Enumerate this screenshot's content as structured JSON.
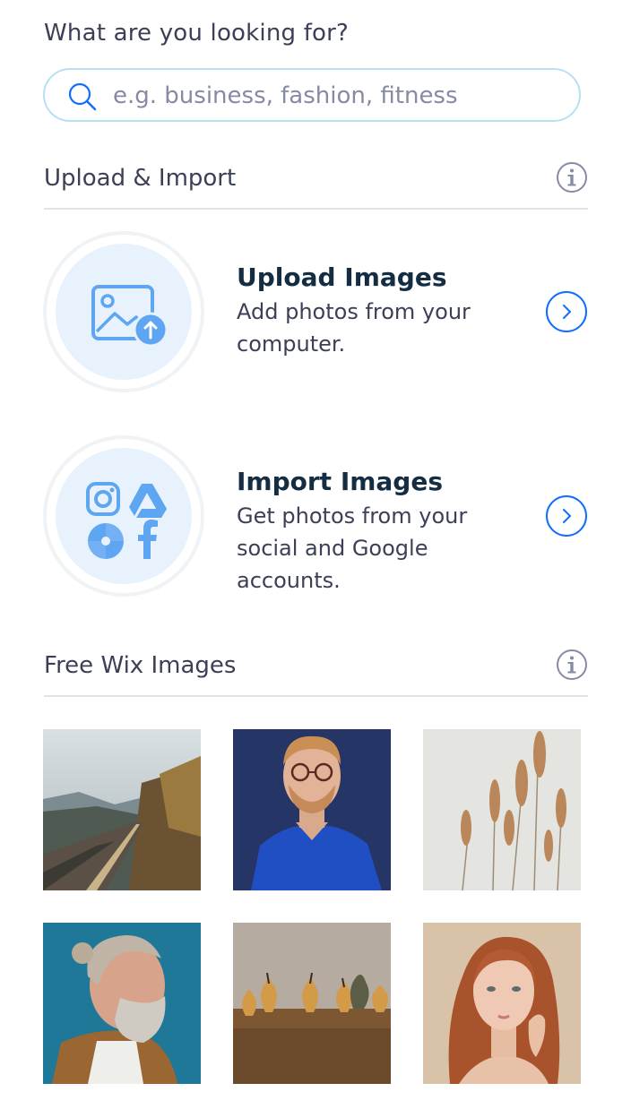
{
  "search": {
    "label": "What are you looking for?",
    "placeholder": "e.g. business, fashion, fitness"
  },
  "upload_section": {
    "title": "Upload & Import",
    "cards": [
      {
        "title": "Upload Images",
        "desc": "Add photos from your computer.",
        "icon": "upload-image-icon"
      },
      {
        "title": "Import Images",
        "desc": "Get photos from your social and Google accounts.",
        "icon": "social-import-icon"
      }
    ]
  },
  "free_section": {
    "title": "Free Wix Images",
    "images": [
      {
        "icon": "road-photo"
      },
      {
        "icon": "man-glasses-photo"
      },
      {
        "icon": "pampas-grass-photo"
      },
      {
        "icon": "bearded-man-photo"
      },
      {
        "icon": "pears-photo"
      },
      {
        "icon": "red-hair-woman-photo"
      }
    ]
  },
  "colors": {
    "accent": "#116dff",
    "icon_blue": "#5ea6f2",
    "bubble": "#e7f2fd",
    "search_border": "#b8e0f3"
  }
}
